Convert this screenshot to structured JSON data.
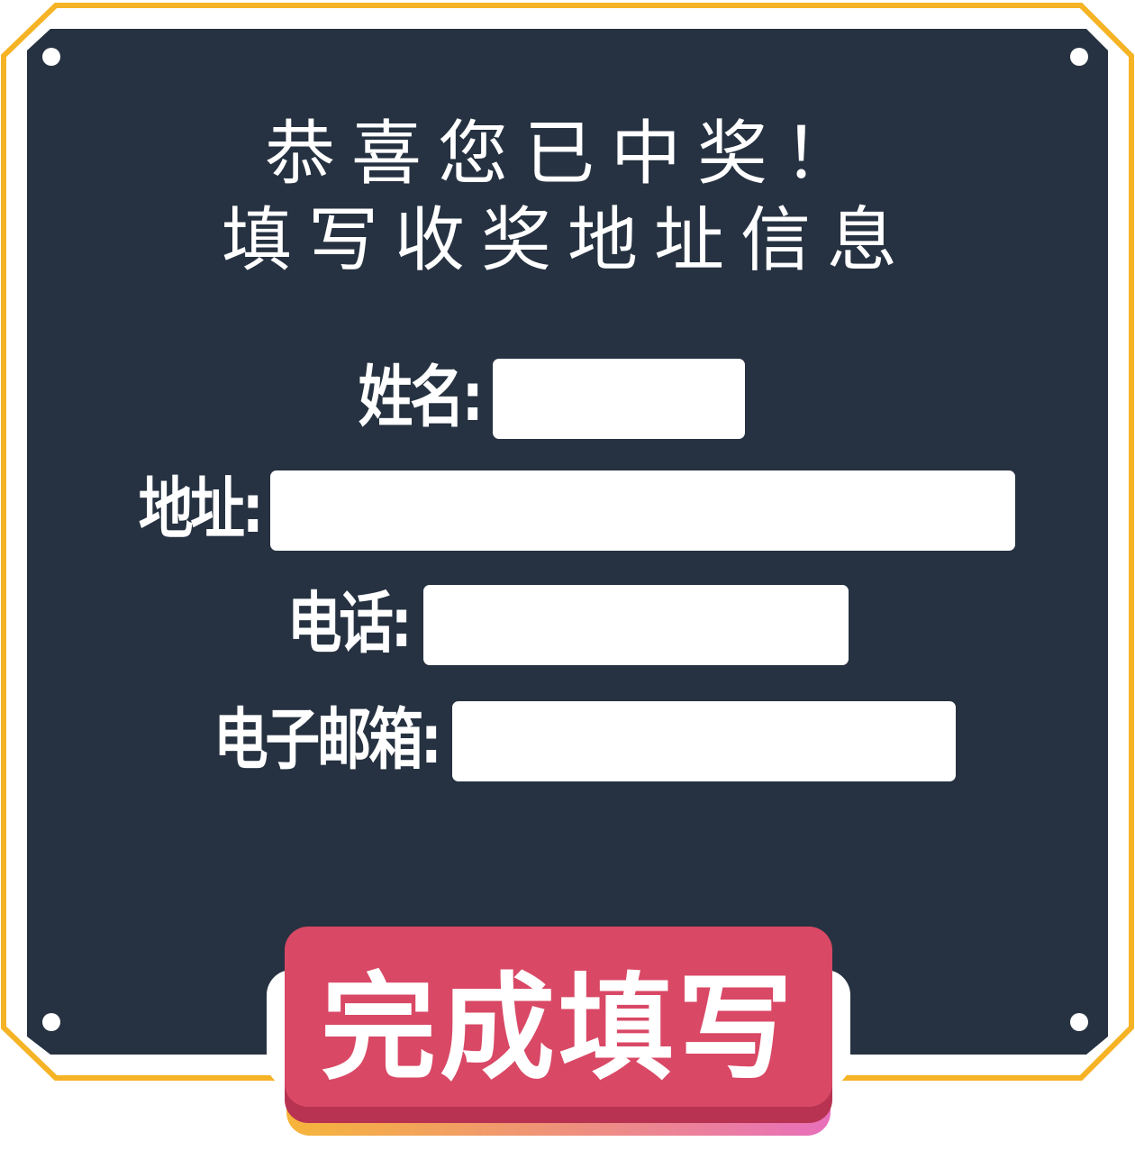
{
  "dialog": {
    "title_line1": "恭喜您已中奖！",
    "title_line2": "填写收奖地址信息"
  },
  "form": {
    "name_label": "姓名:",
    "address_label": "地址:",
    "phone_label": "电话:",
    "email_label": "电子邮箱:",
    "name_value": "",
    "address_value": "",
    "phone_value": "",
    "email_value": ""
  },
  "submit": {
    "label": "完成填写"
  },
  "colors": {
    "panel": "#263241",
    "border": "#f5b325",
    "button": "#d94865",
    "button_shadow": "#b83352",
    "text": "#ffffff"
  }
}
